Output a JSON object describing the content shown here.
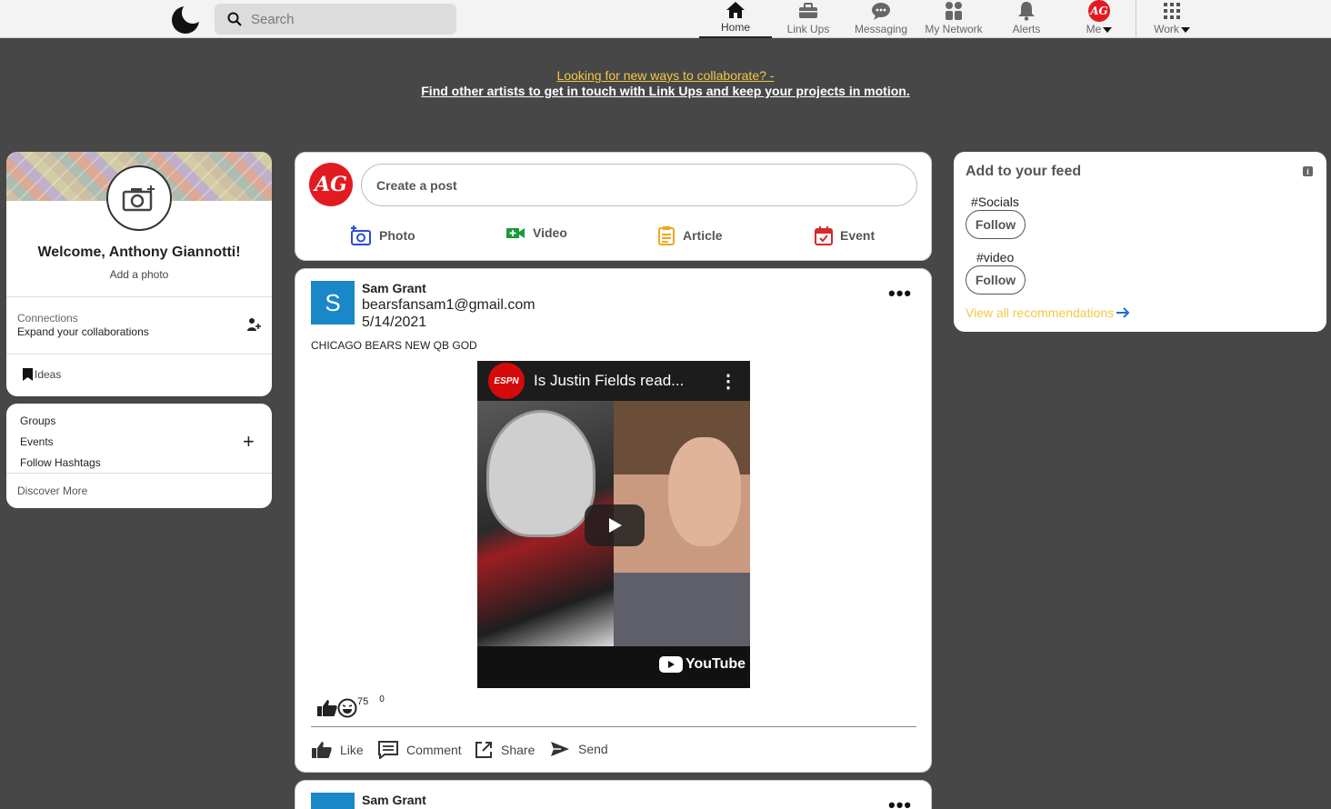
{
  "header": {
    "search_placeholder": "Search",
    "nav": [
      {
        "label": "Home",
        "icon": "home-icon"
      },
      {
        "label": "Link Ups",
        "icon": "briefcase-icon"
      },
      {
        "label": "Messaging",
        "icon": "chat-icon"
      },
      {
        "label": "My Network",
        "icon": "people-icon"
      },
      {
        "label": "Alerts",
        "icon": "bell-icon"
      },
      {
        "label": "Me",
        "icon": "avatar"
      },
      {
        "label": "Work",
        "icon": "grid-icon"
      }
    ],
    "avatar_initials": "AG"
  },
  "banner": {
    "line1": "Looking for new ways to collaborate? -",
    "line2": "Find other artists to get in touch with Link Ups and keep your projects in motion."
  },
  "profile": {
    "welcome": "Welcome, Anthony Giannotti!",
    "add_photo": "Add a photo",
    "connections_label": "Connections",
    "connections_sub": "Expand your collaborations",
    "ideas": "Ideas"
  },
  "groups": {
    "items": [
      "Groups",
      "Events",
      "Follow Hashtags"
    ],
    "discover": "Discover More"
  },
  "composer": {
    "avatar_initials": "AG",
    "placeholder": "Create a post",
    "actions": [
      {
        "label": "Photo",
        "icon": "photo-icon",
        "color": "#2b4bd6"
      },
      {
        "label": "Video",
        "icon": "video-icon",
        "color": "#1a9b3a"
      },
      {
        "label": "Article",
        "icon": "article-icon",
        "color": "#f0a71f"
      },
      {
        "label": "Event",
        "icon": "calendar-icon",
        "color": "#d62b2b"
      }
    ]
  },
  "post": {
    "avatar_letter": "S",
    "author": "Sam Grant",
    "email": "bearsfansam1@gmail.com",
    "date": "5/14/2021",
    "text": "CHICAGO BEARS NEW QB GOD",
    "video_title": "Is Justin Fields read...",
    "video_brand": "ESPN",
    "yt_label": "YouTube",
    "reaction_count": "75",
    "comment_count": "0",
    "actions": [
      "Like",
      "Comment",
      "Share",
      "Send"
    ]
  },
  "post2": {
    "author": "Sam Grant"
  },
  "feed": {
    "title": "Add to your feed",
    "tags": [
      "#Socials",
      "#video"
    ],
    "follow_label": "Follow",
    "view_all": "View all recommendations"
  },
  "colors": {
    "background": "#474747",
    "accent_yellow": "#f6c744",
    "brand_red": "#e21b23",
    "post_avatar": "#1a87c9"
  }
}
